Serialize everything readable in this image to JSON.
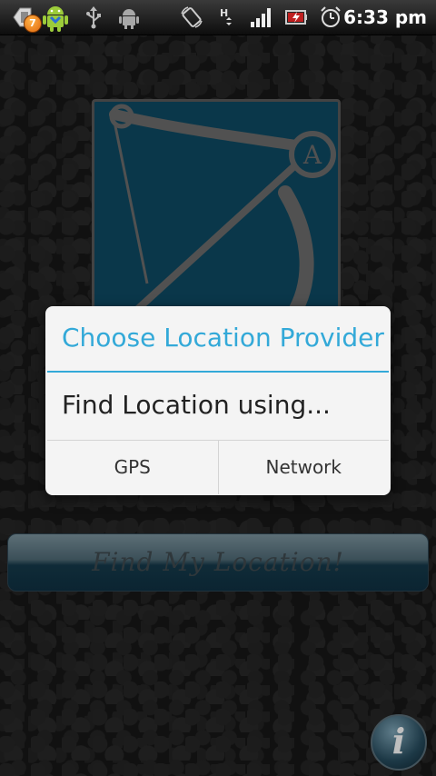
{
  "status_bar": {
    "notification_count": "7",
    "time": "6:33 pm"
  },
  "dialog": {
    "title": "Choose Location Provider",
    "message": "Find Location using...",
    "buttons": [
      {
        "label": "GPS"
      },
      {
        "label": "Network"
      }
    ]
  },
  "main": {
    "find_button_label": "Find My Location!",
    "info_button_glyph": "i",
    "logo_letter": "A"
  },
  "colors": {
    "dialog_accent": "#33a9d8",
    "logo_background": "#0e4a63",
    "logo_line": "#6c6c6c"
  },
  "icons": [
    "notification-app-icon",
    "android-debug-icon",
    "usb-icon",
    "android-icon",
    "rotate-icon",
    "hspa-icon",
    "signal-icon",
    "battery-charging-icon",
    "alarm-icon",
    "info-icon",
    "bow-arrow-logo"
  ]
}
